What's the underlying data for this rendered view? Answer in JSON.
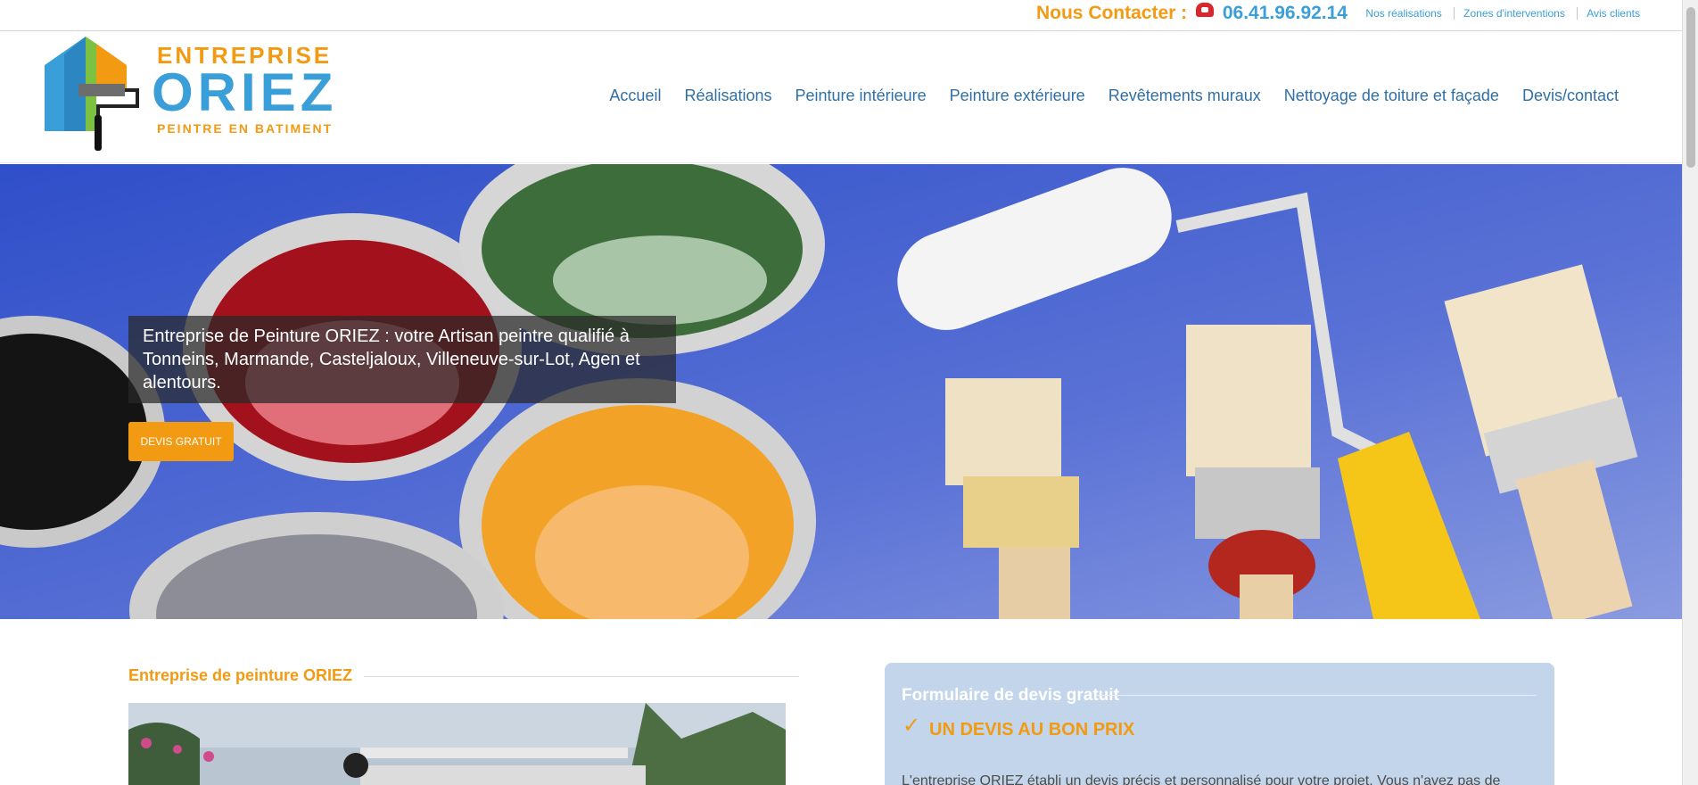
{
  "topbar": {
    "contact_label": "Nous Contacter :",
    "phone_icon": "telephone-icon",
    "phone": "06.41.96.92.14",
    "links": [
      "Nos réalisations",
      "Zones d'interventions",
      "Avis clients"
    ]
  },
  "logo": {
    "line1": "ENTREPRISE",
    "line2": "ORIEZ",
    "line3": "PEINTRE EN BATIMENT"
  },
  "nav": {
    "items": [
      "Accueil",
      "Réalisations",
      "Peinture intérieure",
      "Peinture extérieure",
      "Revêtements muraux",
      "Nettoyage de toiture et façade",
      "Devis/contact"
    ]
  },
  "hero": {
    "caption": "Entreprise de Peinture ORIEZ : votre Artisan peintre qualifié à Tonneins, Marmande, Casteljaloux, Villeneuve-sur-Lot, Agen et alentours.",
    "button": "DEVIS GRATUIT"
  },
  "content": {
    "section_title": "Entreprise de peinture ORIEZ"
  },
  "form": {
    "title": "Formulaire de devis gratuit",
    "check_icon": "checkmark-icon",
    "heading": "UN DEVIS AU BON PRIX",
    "text": "L'entreprise ORIEZ établi un devis précis et personnalisé pour votre projet. Vous n'avez pas de"
  },
  "colors": {
    "orange": "#f29a12",
    "blue": "#3a9fd8",
    "nav_blue": "#2f6fa5",
    "form_bg": "#c2d5ea"
  }
}
